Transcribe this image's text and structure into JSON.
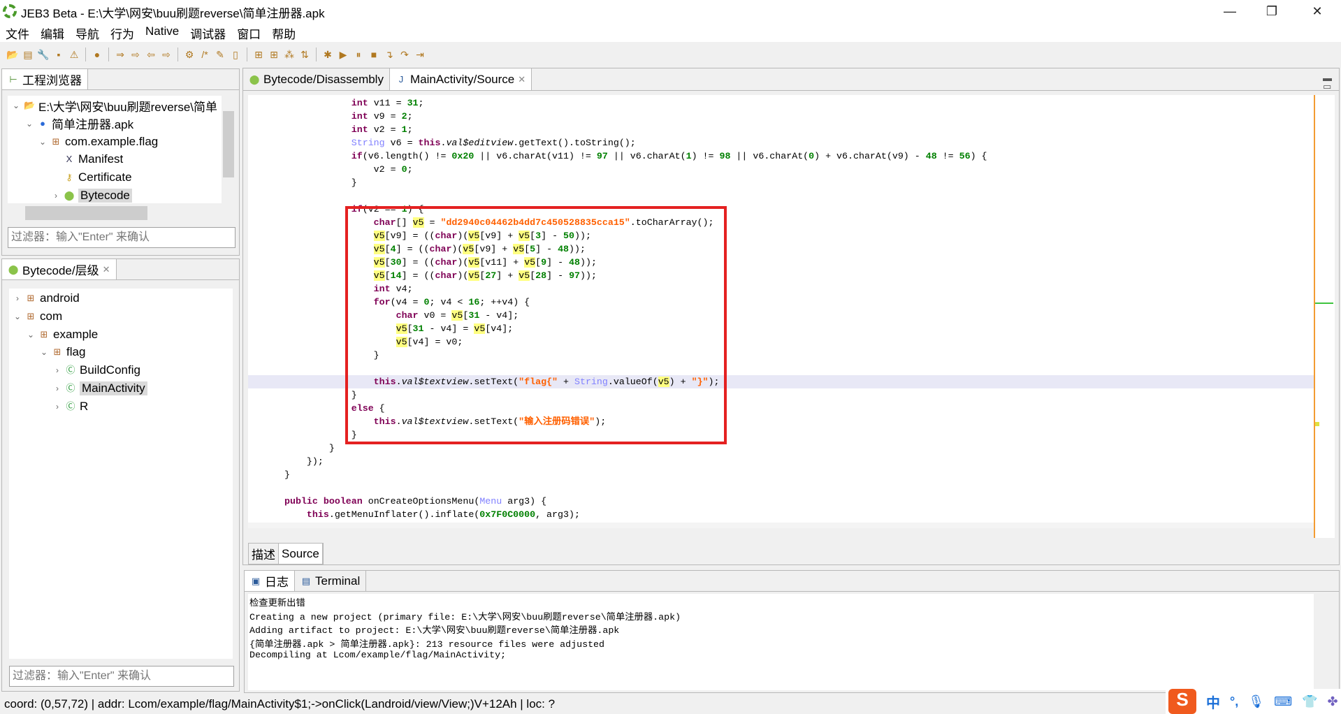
{
  "window": {
    "title": "JEB3 Beta - E:\\大学\\网安\\buu刷题reverse\\简单注册器.apk",
    "minimize": "—",
    "restore": "❐",
    "close": "✕"
  },
  "menu": [
    "文件",
    "编辑",
    "导航",
    "行为",
    "Native",
    "调试器",
    "窗口",
    "帮助"
  ],
  "toolbar": [
    {
      "name": "open-icon",
      "g": "📂"
    },
    {
      "name": "save-icon",
      "g": "▤"
    },
    {
      "name": "wrench-icon",
      "g": "🔧"
    },
    {
      "name": "window-icon",
      "g": "▪"
    },
    {
      "name": "warning-icon",
      "g": "⚠"
    },
    "sep",
    {
      "name": "globe-icon",
      "g": "●"
    },
    "sep",
    {
      "name": "jump-icon",
      "g": "⇒"
    },
    {
      "name": "navigate-icon",
      "g": "⇨"
    },
    {
      "name": "back-icon",
      "g": "⇦"
    },
    {
      "name": "forward-icon",
      "g": "⇨"
    },
    "sep",
    {
      "name": "decompile-icon",
      "g": "⚙"
    },
    {
      "name": "comment-icon",
      "g": "/*"
    },
    {
      "name": "pencil-icon",
      "g": "✎"
    },
    {
      "name": "document-icon",
      "g": "▯"
    },
    "sep",
    {
      "name": "grid-icon",
      "g": "⊞"
    },
    {
      "name": "graph-icon",
      "g": "⊞"
    },
    {
      "name": "nodes-icon",
      "g": "⁂"
    },
    {
      "name": "sort-icon",
      "g": "⇅"
    },
    "sep",
    {
      "name": "debug-icon",
      "g": "✱"
    },
    {
      "name": "run-icon",
      "g": "▶"
    },
    {
      "name": "pause-icon",
      "g": "⏸"
    },
    {
      "name": "stop-icon",
      "g": "■"
    },
    {
      "name": "step-into-icon",
      "g": "↴"
    },
    {
      "name": "step-over-icon",
      "g": "↷"
    },
    {
      "name": "step-out-icon",
      "g": "⇥"
    }
  ],
  "project_explorer": {
    "tab": "工程浏览器",
    "items": [
      {
        "label": "E:\\大学\\网安\\buu刷题reverse\\简单",
        "icon": "folder-icon",
        "level": 0,
        "chev": "⌄"
      },
      {
        "label": "简单注册器.apk",
        "icon": "apk-icon",
        "level": 1,
        "chev": "⌄"
      },
      {
        "label": "com.example.flag",
        "icon": "package-icon",
        "level": 2,
        "chev": "⌄"
      },
      {
        "label": "Manifest",
        "icon": "xml-icon",
        "level": 3,
        "chev": ""
      },
      {
        "label": "Certificate",
        "icon": "key-icon",
        "level": 3,
        "chev": ""
      },
      {
        "label": "Bytecode",
        "icon": "android-icon",
        "level": 3,
        "chev": "›",
        "selected": true
      }
    ],
    "filter_placeholder": "过滤器：输入\"Enter\" 来确认"
  },
  "hierarchy": {
    "tab": "Bytecode/层级",
    "items": [
      {
        "label": "android",
        "icon": "package-icon",
        "level": 0,
        "chev": "›"
      },
      {
        "label": "com",
        "icon": "package-icon",
        "level": 0,
        "chev": "⌄"
      },
      {
        "label": "example",
        "icon": "package-icon",
        "level": 1,
        "chev": "⌄"
      },
      {
        "label": "flag",
        "icon": "package-icon",
        "level": 2,
        "chev": "⌄"
      },
      {
        "label": "BuildConfig",
        "icon": "class-icon",
        "level": 3,
        "chev": "›"
      },
      {
        "label": "MainActivity",
        "icon": "class-icon",
        "level": 3,
        "chev": "›",
        "selected": true
      },
      {
        "label": "R",
        "icon": "class-icon",
        "level": 3,
        "chev": "›"
      }
    ],
    "filter_placeholder": "过滤器：输入\"Enter\" 来确认"
  },
  "editor": {
    "tabs": [
      "Bytecode/Disassembly",
      "MainActivity/Source"
    ],
    "bottom_tabs": [
      "描述",
      "Source"
    ],
    "lines": [
      [
        [
          "",
          "            "
        ],
        [
          "k",
          "int"
        ],
        [
          "",
          " v11 = "
        ],
        [
          "n",
          "31"
        ],
        [
          "",
          ";"
        ]
      ],
      [
        [
          "",
          "            "
        ],
        [
          "k",
          "int"
        ],
        [
          "",
          " v9 = "
        ],
        [
          "n",
          "2"
        ],
        [
          "",
          ";"
        ]
      ],
      [
        [
          "",
          "            "
        ],
        [
          "k",
          "int"
        ],
        [
          "",
          " v2 = "
        ],
        [
          "n",
          "1"
        ],
        [
          "",
          ";"
        ]
      ],
      [
        [
          "",
          "            "
        ],
        [
          "t",
          "String"
        ],
        [
          "",
          " v6 = "
        ],
        [
          "k",
          "this"
        ],
        [
          "",
          "."
        ],
        [
          "i",
          "val$editview"
        ],
        [
          "",
          ".getText().toString();"
        ]
      ],
      [
        [
          "",
          "            "
        ],
        [
          "k",
          "if"
        ],
        [
          "",
          "(v6.length() != "
        ],
        [
          "n",
          "0x20"
        ],
        [
          "",
          " || v6.charAt(v11) != "
        ],
        [
          "n",
          "97"
        ],
        [
          "",
          " || v6.charAt("
        ],
        [
          "n",
          "1"
        ],
        [
          "",
          ") != "
        ],
        [
          "n",
          "98"
        ],
        [
          "",
          " || v6.charAt("
        ],
        [
          "n",
          "0"
        ],
        [
          "",
          ") + v6.charAt(v9) - "
        ],
        [
          "n",
          "48"
        ],
        [
          "",
          " != "
        ],
        [
          "n",
          "56"
        ],
        [
          "",
          ") {"
        ]
      ],
      [
        [
          "",
          "                v2 = "
        ],
        [
          "n",
          "0"
        ],
        [
          "",
          ";"
        ]
      ],
      [
        [
          "",
          "            }"
        ]
      ],
      [],
      [
        [
          "",
          "            "
        ],
        [
          "k",
          "if"
        ],
        [
          "",
          "(v2 == "
        ],
        [
          "n",
          "1"
        ],
        [
          "",
          ") {"
        ]
      ],
      [
        [
          "",
          "                "
        ],
        [
          "k",
          "char"
        ],
        [
          "",
          "[] "
        ],
        [
          "h",
          "v5"
        ],
        [
          "",
          " = "
        ],
        [
          "s",
          "\"dd2940c04462b4dd7c450528835cca15\""
        ],
        [
          "",
          ".toCharArray();"
        ]
      ],
      [
        [
          "",
          "                "
        ],
        [
          "h",
          "v5"
        ],
        [
          "",
          "[v9] = (("
        ],
        [
          "k",
          "char"
        ],
        [
          "",
          ")("
        ],
        [
          "h",
          "v5"
        ],
        [
          "",
          "[v9] + "
        ],
        [
          "h",
          "v5"
        ],
        [
          "",
          "["
        ],
        [
          "n",
          "3"
        ],
        [
          "",
          "] - "
        ],
        [
          "n",
          "50"
        ],
        [
          "",
          "));"
        ]
      ],
      [
        [
          "",
          "                "
        ],
        [
          "h",
          "v5"
        ],
        [
          "",
          "["
        ],
        [
          "n",
          "4"
        ],
        [
          "",
          "] = (("
        ],
        [
          "k",
          "char"
        ],
        [
          "",
          ")("
        ],
        [
          "h",
          "v5"
        ],
        [
          "",
          "[v9] + "
        ],
        [
          "h",
          "v5"
        ],
        [
          "",
          "["
        ],
        [
          "n",
          "5"
        ],
        [
          "",
          "] - "
        ],
        [
          "n",
          "48"
        ],
        [
          "",
          "));"
        ]
      ],
      [
        [
          "",
          "                "
        ],
        [
          "h",
          "v5"
        ],
        [
          "",
          "["
        ],
        [
          "n",
          "30"
        ],
        [
          "",
          "] = (("
        ],
        [
          "k",
          "char"
        ],
        [
          "",
          ")("
        ],
        [
          "h",
          "v5"
        ],
        [
          "",
          "[v11] + "
        ],
        [
          "h",
          "v5"
        ],
        [
          "",
          "["
        ],
        [
          "n",
          "9"
        ],
        [
          "",
          "] - "
        ],
        [
          "n",
          "48"
        ],
        [
          "",
          "));"
        ]
      ],
      [
        [
          "",
          "                "
        ],
        [
          "h",
          "v5"
        ],
        [
          "",
          "["
        ],
        [
          "n",
          "14"
        ],
        [
          "",
          "] = (("
        ],
        [
          "k",
          "char"
        ],
        [
          "",
          ")("
        ],
        [
          "h",
          "v5"
        ],
        [
          "",
          "["
        ],
        [
          "n",
          "27"
        ],
        [
          "",
          "] + "
        ],
        [
          "h",
          "v5"
        ],
        [
          "",
          "["
        ],
        [
          "n",
          "28"
        ],
        [
          "",
          "] - "
        ],
        [
          "n",
          "97"
        ],
        [
          "",
          "));"
        ]
      ],
      [
        [
          "",
          "                "
        ],
        [
          "k",
          "int"
        ],
        [
          "",
          " v4;"
        ]
      ],
      [
        [
          "",
          "                "
        ],
        [
          "k",
          "for"
        ],
        [
          "",
          "(v4 = "
        ],
        [
          "n",
          "0"
        ],
        [
          "",
          "; v4 < "
        ],
        [
          "n",
          "16"
        ],
        [
          "",
          "; ++v4) {"
        ]
      ],
      [
        [
          "",
          "                    "
        ],
        [
          "k",
          "char"
        ],
        [
          "",
          " v0 = "
        ],
        [
          "h",
          "v5"
        ],
        [
          "",
          "["
        ],
        [
          "n",
          "31"
        ],
        [
          "",
          " - v4];"
        ]
      ],
      [
        [
          "",
          "                    "
        ],
        [
          "h",
          "v5"
        ],
        [
          "",
          "["
        ],
        [
          "n",
          "31"
        ],
        [
          "",
          " - v4] = "
        ],
        [
          "h",
          "v5"
        ],
        [
          "",
          "[v4];"
        ]
      ],
      [
        [
          "",
          "                    "
        ],
        [
          "h",
          "v5"
        ],
        [
          "",
          "[v4] = v0;"
        ]
      ],
      [
        [
          "",
          "                }"
        ]
      ],
      [],
      [
        [
          "",
          "                "
        ],
        [
          "k",
          "this"
        ],
        [
          "",
          "."
        ],
        [
          "i",
          "val$textview"
        ],
        [
          "",
          ".setText("
        ],
        [
          "s",
          "\"flag{\""
        ],
        [
          "",
          " + "
        ],
        [
          "t",
          "String"
        ],
        [
          "",
          ".valueOf("
        ],
        [
          "h",
          "v5"
        ],
        [
          "",
          ") + "
        ],
        [
          "s",
          "\"}\""
        ],
        [
          "",
          ");"
        ]
      ],
      [
        [
          "",
          "            }"
        ]
      ],
      [
        [
          "",
          "            "
        ],
        [
          "k",
          "else"
        ],
        [
          "",
          " {"
        ]
      ],
      [
        [
          "",
          "                "
        ],
        [
          "k",
          "this"
        ],
        [
          "",
          "."
        ],
        [
          "i",
          "val$textview"
        ],
        [
          "",
          ".setText("
        ],
        [
          "s",
          "\"输入注册码错误\""
        ],
        [
          "",
          ");"
        ]
      ],
      [
        [
          "",
          "            }"
        ]
      ],
      [
        [
          "",
          "        }"
        ]
      ],
      [
        [
          "",
          "    });"
        ]
      ],
      [
        [
          "",
          "}"
        ]
      ],
      [],
      [
        [
          "k",
          "public"
        ],
        [
          "",
          " "
        ],
        [
          "k",
          "boolean"
        ],
        [
          "",
          " onCreateOptionsMenu("
        ],
        [
          "t",
          "Menu"
        ],
        [
          "",
          " arg3) {"
        ]
      ],
      [
        [
          "",
          "    "
        ],
        [
          "k",
          "this"
        ],
        [
          "",
          ".getMenuInflater().inflate("
        ],
        [
          "n",
          "0x7F0C0000"
        ],
        [
          "",
          ", arg3);"
        ]
      ]
    ],
    "caret_line": 21
  },
  "log": {
    "tabs": [
      "日志",
      "Terminal"
    ],
    "lines": [
      "检查更新出错",
      "Creating a new project (primary file: E:\\大学\\网安\\buu刷题reverse\\简单注册器.apk)",
      "Adding artifact to project: E:\\大学\\网安\\buu刷题reverse\\简单注册器.apk",
      "{简单注册器.apk > 简单注册器.apk}: 213 resource files were adjusted",
      "Decompiling at Lcom/example/flag/MainActivity;"
    ]
  },
  "status": "coord: (0,57,72) | addr: Lcom/example/flag/MainActivity$1;->onClick(Landroid/view/View;)V+12Ah | loc: ?",
  "ime": {
    "logo": "S",
    "mode": "中",
    "punct": "°,",
    "items": [
      "microphone-icon",
      "keyboard-icon",
      "skin-icon",
      "apps-icon"
    ]
  },
  "colors": {
    "keyword": "#7f0055",
    "number": "#008000",
    "string": "#ff6000",
    "type": "#8080ff",
    "highlight": "#ffff80",
    "annotation_box": "#e42121"
  }
}
